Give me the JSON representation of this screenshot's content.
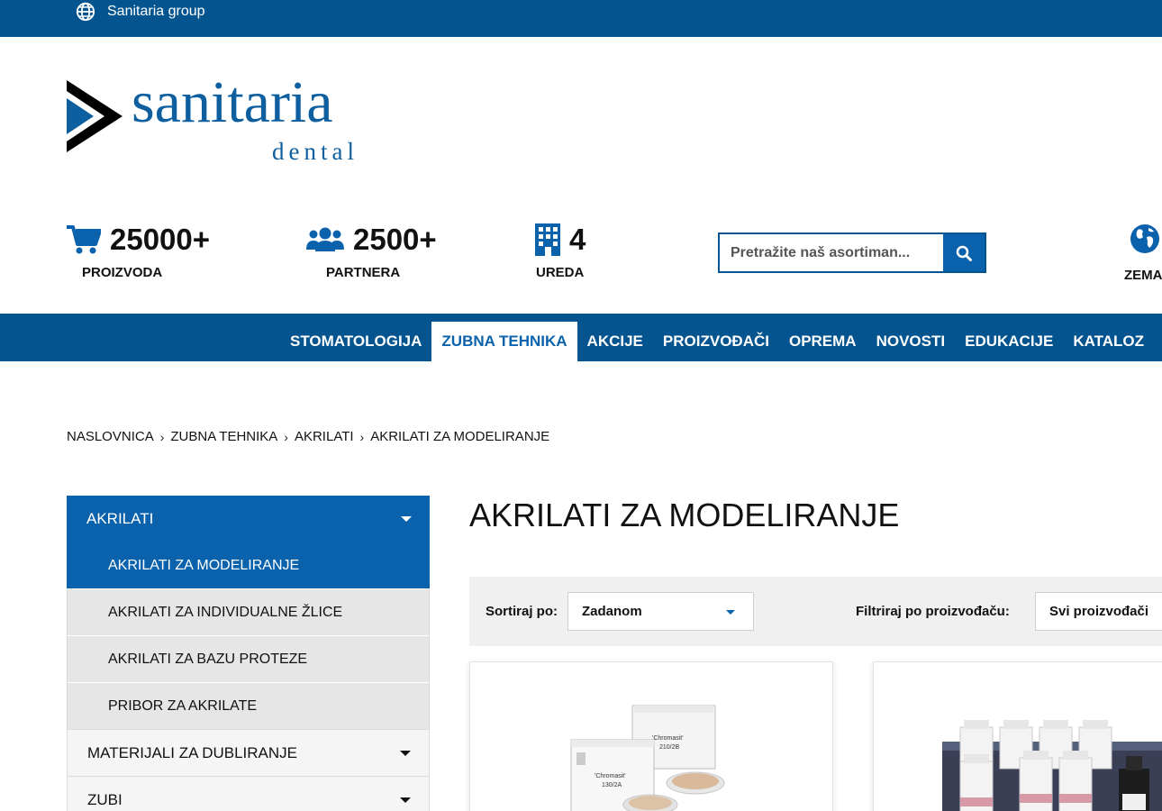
{
  "topbar": {
    "group_label": "Sanitaria group",
    "icon": "globe-icon"
  },
  "logo": {
    "word1": "sanitaria",
    "word2": "dental"
  },
  "stats": [
    {
      "icon": "cart-icon",
      "value": "25000+",
      "label": "PROIZVODA"
    },
    {
      "icon": "users-icon",
      "value": "2500+",
      "label": "PARTNERA"
    },
    {
      "icon": "building-icon",
      "value": "4",
      "label": "UREDA"
    }
  ],
  "search": {
    "placeholder": "Pretražite naš asortiman...",
    "icon": "search-icon"
  },
  "country": {
    "icon": "earth-icon",
    "label": "ZEMA"
  },
  "nav": {
    "items": [
      "STOMATOLOGIJA",
      "ZUBNA TEHNIKA",
      "AKCIJE",
      "PROIZVOĐAČI",
      "OPREMA",
      "NOVOSTI",
      "EDUKACIJE",
      "KATALOZ"
    ],
    "active": "ZUBNA TEHNIKA"
  },
  "breadcrumb": [
    "NASLOVNICA",
    "ZUBNA TEHNIKA",
    "AKRILATI",
    "AKRILATI ZA MODELIRANJE"
  ],
  "sidebar": {
    "head": "AKRILATI",
    "subs": [
      "AKRILATI ZA MODELIRANJE",
      "AKRILATI ZA INDIVIDUALNE ŽLICE",
      "AKRILATI ZA BAZU PROTEZE",
      "PRIBOR ZA AKRILATE"
    ],
    "cats": [
      "MATERIJALI ZA DUBLIRANJE",
      "ZUBI"
    ]
  },
  "page_title": "AKRILATI ZA MODELIRANJE",
  "filters": {
    "sort_label": "Sortiraj po:",
    "sort_value": "Zadanom",
    "manufacturer_label": "Filtriraj po proizvođaču:",
    "manufacturer_value": "Svi proizvođači"
  },
  "products": [
    {
      "image_text": [
        "'Chromasit'",
        "210/2B",
        "'Chromasit'",
        "130/2A"
      ]
    },
    {
      "image_text": []
    }
  ],
  "colors": {
    "brand_blue": "#04558f",
    "accent_blue": "#0a62ad"
  }
}
